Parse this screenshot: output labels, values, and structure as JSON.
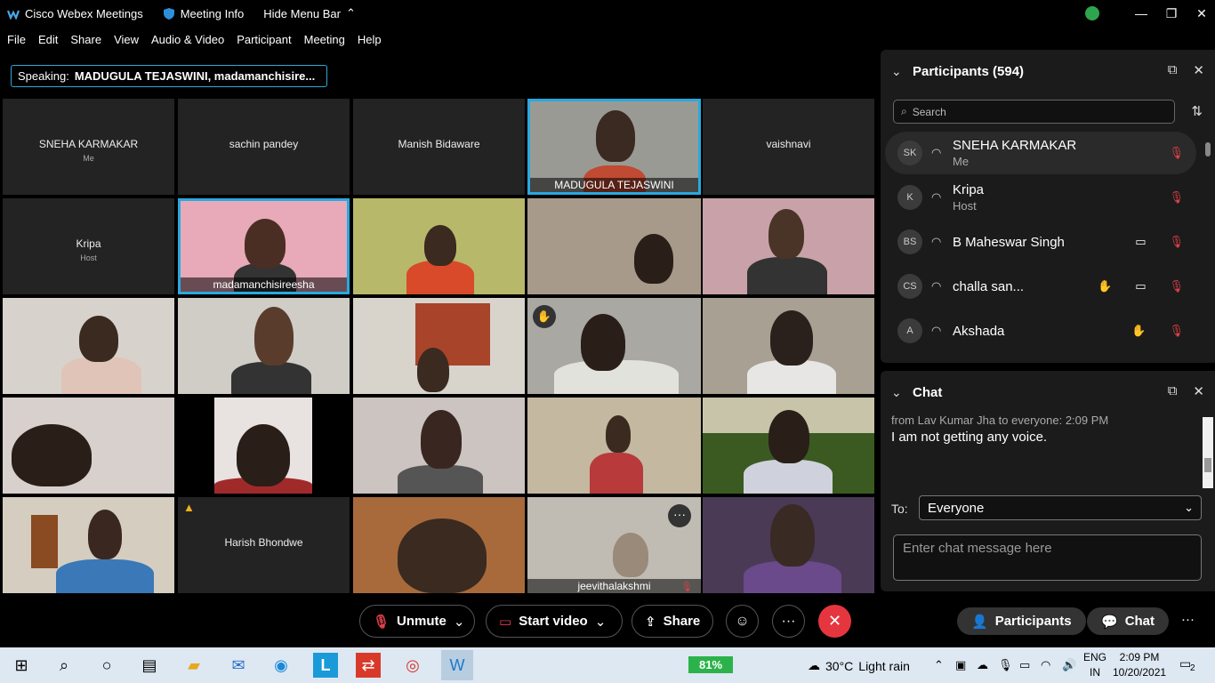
{
  "titlebar": {
    "app_title": "Cisco Webex Meetings",
    "meeting_info": "Meeting Info",
    "hide_menu": "Hide Menu Bar"
  },
  "menu": [
    "File",
    "Edit",
    "Share",
    "View",
    "Audio & Video",
    "Participant",
    "Meeting",
    "Help"
  ],
  "speaking": {
    "label": "Speaking:",
    "names": "MADUGULA TEJASWINI,  madamanchisire..."
  },
  "tiles": {
    "sneha": {
      "name": "SNEHA KARMAKAR",
      "sub": "Me"
    },
    "sachin": {
      "name": "sachin pandey"
    },
    "manish": {
      "name": "Manish Bidaware"
    },
    "madugula": {
      "name": "MADUGULA TEJASWINI"
    },
    "vaishnavi": {
      "name": "vaishnavi"
    },
    "kripa": {
      "name": "Kripa",
      "sub": "Host"
    },
    "madamanchi": {
      "name": "madamanchisireesha"
    },
    "harish": {
      "name": "Harish Bhondwe"
    },
    "jeevitha": {
      "name": "jeevithalakshmi"
    }
  },
  "participants_panel": {
    "title": "Participants (594)",
    "search_placeholder": "Search",
    "rows": [
      {
        "initials": "SK",
        "name": "SNEHA KARMAKAR",
        "role": "Me"
      },
      {
        "initials": "K",
        "name": "Kripa",
        "role": "Host"
      },
      {
        "initials": "BS",
        "name": "B Maheswar Singh"
      },
      {
        "initials": "CS",
        "name": "challa san..."
      },
      {
        "initials": "A",
        "name": "Akshada"
      }
    ]
  },
  "chat_panel": {
    "title": "Chat",
    "meta": "from Lav Kumar Jha to everyone:    2:09 PM",
    "message": "I am not getting any voice.",
    "to_label": "To:",
    "to_value": "Everyone",
    "input_placeholder": "Enter chat message here"
  },
  "controls": {
    "unmute": "Unmute",
    "start_video": "Start video",
    "share": "Share",
    "participants": "Participants",
    "chat": "Chat"
  },
  "taskbar": {
    "battery": "81%",
    "temperature": "30°C",
    "weather": "Light rain",
    "lang1": "ENG",
    "lang2": "IN",
    "time": "2:09 PM",
    "date": "10/20/2021",
    "notifications": "2"
  }
}
